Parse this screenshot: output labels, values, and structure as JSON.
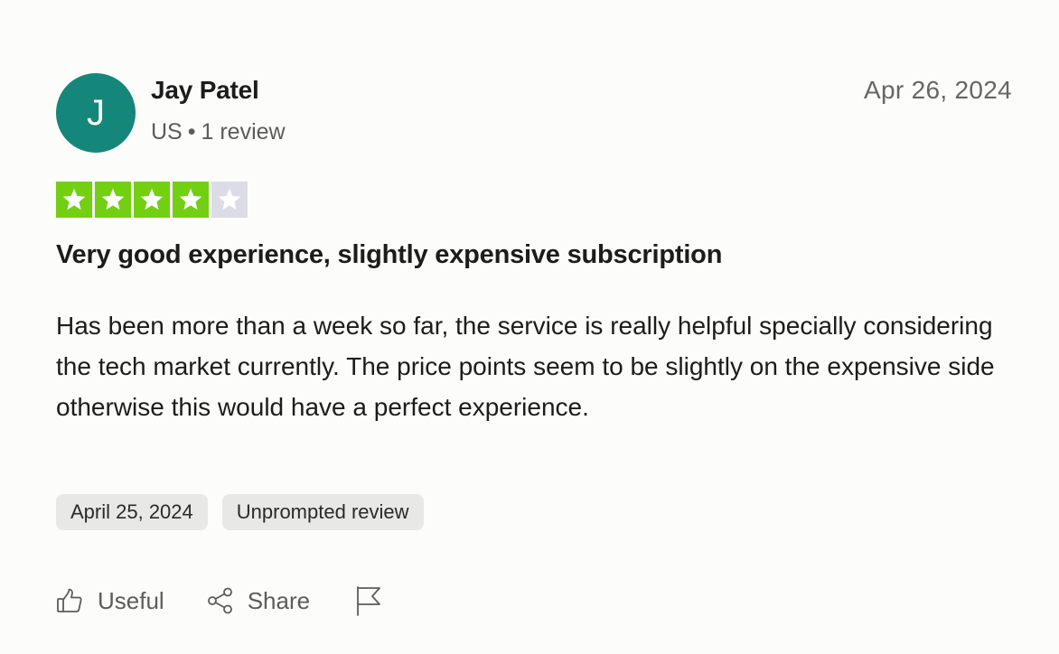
{
  "reviewer": {
    "initial": "J",
    "name": "Jay Patel",
    "country": "US",
    "separator": "•",
    "review_count": "1 review",
    "avatar_color": "#14877a"
  },
  "review": {
    "date": "Apr 26, 2024",
    "rating": 4,
    "max_rating": 5,
    "star_color": "#73cf11",
    "title": "Very good experience, slightly expensive subscription",
    "body": "Has been more than a week so far, the service is really helpful specially considering the tech market currently. The price points seem to be slightly on the expensive side otherwise this would have a perfect experience.",
    "experience_date": "April 25, 2024",
    "tag": "Unprompted review"
  },
  "actions": {
    "useful_label": "Useful",
    "share_label": "Share",
    "useful_icon": "thumbs-up-icon",
    "share_icon": "share-icon",
    "report_icon": "flag-icon"
  }
}
